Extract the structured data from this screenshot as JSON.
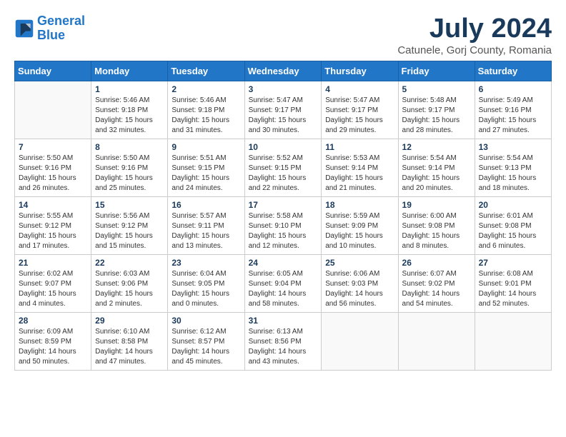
{
  "logo": {
    "line1": "General",
    "line2": "Blue"
  },
  "title": "July 2024",
  "subtitle": "Catunele, Gorj County, Romania",
  "weekdays": [
    "Sunday",
    "Monday",
    "Tuesday",
    "Wednesday",
    "Thursday",
    "Friday",
    "Saturday"
  ],
  "weeks": [
    [
      {
        "day": "",
        "info": ""
      },
      {
        "day": "1",
        "info": "Sunrise: 5:46 AM\nSunset: 9:18 PM\nDaylight: 15 hours\nand 32 minutes."
      },
      {
        "day": "2",
        "info": "Sunrise: 5:46 AM\nSunset: 9:18 PM\nDaylight: 15 hours\nand 31 minutes."
      },
      {
        "day": "3",
        "info": "Sunrise: 5:47 AM\nSunset: 9:17 PM\nDaylight: 15 hours\nand 30 minutes."
      },
      {
        "day": "4",
        "info": "Sunrise: 5:47 AM\nSunset: 9:17 PM\nDaylight: 15 hours\nand 29 minutes."
      },
      {
        "day": "5",
        "info": "Sunrise: 5:48 AM\nSunset: 9:17 PM\nDaylight: 15 hours\nand 28 minutes."
      },
      {
        "day": "6",
        "info": "Sunrise: 5:49 AM\nSunset: 9:16 PM\nDaylight: 15 hours\nand 27 minutes."
      }
    ],
    [
      {
        "day": "7",
        "info": "Sunrise: 5:50 AM\nSunset: 9:16 PM\nDaylight: 15 hours\nand 26 minutes."
      },
      {
        "day": "8",
        "info": "Sunrise: 5:50 AM\nSunset: 9:16 PM\nDaylight: 15 hours\nand 25 minutes."
      },
      {
        "day": "9",
        "info": "Sunrise: 5:51 AM\nSunset: 9:15 PM\nDaylight: 15 hours\nand 24 minutes."
      },
      {
        "day": "10",
        "info": "Sunrise: 5:52 AM\nSunset: 9:15 PM\nDaylight: 15 hours\nand 22 minutes."
      },
      {
        "day": "11",
        "info": "Sunrise: 5:53 AM\nSunset: 9:14 PM\nDaylight: 15 hours\nand 21 minutes."
      },
      {
        "day": "12",
        "info": "Sunrise: 5:54 AM\nSunset: 9:14 PM\nDaylight: 15 hours\nand 20 minutes."
      },
      {
        "day": "13",
        "info": "Sunrise: 5:54 AM\nSunset: 9:13 PM\nDaylight: 15 hours\nand 18 minutes."
      }
    ],
    [
      {
        "day": "14",
        "info": "Sunrise: 5:55 AM\nSunset: 9:12 PM\nDaylight: 15 hours\nand 17 minutes."
      },
      {
        "day": "15",
        "info": "Sunrise: 5:56 AM\nSunset: 9:12 PM\nDaylight: 15 hours\nand 15 minutes."
      },
      {
        "day": "16",
        "info": "Sunrise: 5:57 AM\nSunset: 9:11 PM\nDaylight: 15 hours\nand 13 minutes."
      },
      {
        "day": "17",
        "info": "Sunrise: 5:58 AM\nSunset: 9:10 PM\nDaylight: 15 hours\nand 12 minutes."
      },
      {
        "day": "18",
        "info": "Sunrise: 5:59 AM\nSunset: 9:09 PM\nDaylight: 15 hours\nand 10 minutes."
      },
      {
        "day": "19",
        "info": "Sunrise: 6:00 AM\nSunset: 9:08 PM\nDaylight: 15 hours\nand 8 minutes."
      },
      {
        "day": "20",
        "info": "Sunrise: 6:01 AM\nSunset: 9:08 PM\nDaylight: 15 hours\nand 6 minutes."
      }
    ],
    [
      {
        "day": "21",
        "info": "Sunrise: 6:02 AM\nSunset: 9:07 PM\nDaylight: 15 hours\nand 4 minutes."
      },
      {
        "day": "22",
        "info": "Sunrise: 6:03 AM\nSunset: 9:06 PM\nDaylight: 15 hours\nand 2 minutes."
      },
      {
        "day": "23",
        "info": "Sunrise: 6:04 AM\nSunset: 9:05 PM\nDaylight: 15 hours\nand 0 minutes."
      },
      {
        "day": "24",
        "info": "Sunrise: 6:05 AM\nSunset: 9:04 PM\nDaylight: 14 hours\nand 58 minutes."
      },
      {
        "day": "25",
        "info": "Sunrise: 6:06 AM\nSunset: 9:03 PM\nDaylight: 14 hours\nand 56 minutes."
      },
      {
        "day": "26",
        "info": "Sunrise: 6:07 AM\nSunset: 9:02 PM\nDaylight: 14 hours\nand 54 minutes."
      },
      {
        "day": "27",
        "info": "Sunrise: 6:08 AM\nSunset: 9:01 PM\nDaylight: 14 hours\nand 52 minutes."
      }
    ],
    [
      {
        "day": "28",
        "info": "Sunrise: 6:09 AM\nSunset: 8:59 PM\nDaylight: 14 hours\nand 50 minutes."
      },
      {
        "day": "29",
        "info": "Sunrise: 6:10 AM\nSunset: 8:58 PM\nDaylight: 14 hours\nand 47 minutes."
      },
      {
        "day": "30",
        "info": "Sunrise: 6:12 AM\nSunset: 8:57 PM\nDaylight: 14 hours\nand 45 minutes."
      },
      {
        "day": "31",
        "info": "Sunrise: 6:13 AM\nSunset: 8:56 PM\nDaylight: 14 hours\nand 43 minutes."
      },
      {
        "day": "",
        "info": ""
      },
      {
        "day": "",
        "info": ""
      },
      {
        "day": "",
        "info": ""
      }
    ]
  ]
}
